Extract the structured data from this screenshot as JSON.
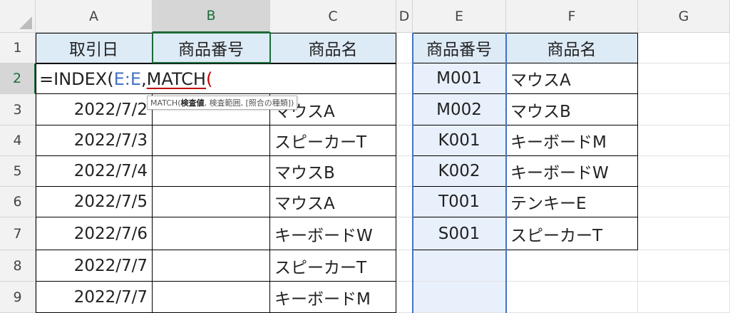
{
  "columns": [
    "A",
    "B",
    "C",
    "D",
    "E",
    "F",
    "G"
  ],
  "rows": [
    "1",
    "2",
    "3",
    "4",
    "5",
    "6",
    "7",
    "8",
    "9"
  ],
  "selected_column": "B",
  "selected_row": "2",
  "left_table": {
    "headers": [
      "取引日",
      "商品番号",
      "商品名"
    ],
    "rows": [
      [
        "",
        "",
        ""
      ],
      [
        "2022/7/2",
        "",
        "マウスA"
      ],
      [
        "2022/7/3",
        "",
        "スピーカーT"
      ],
      [
        "2022/7/4",
        "",
        "マウスB"
      ],
      [
        "2022/7/5",
        "",
        "マウスA"
      ],
      [
        "2022/7/6",
        "",
        "キーボードW"
      ],
      [
        "2022/7/7",
        "",
        "スピーカーT"
      ],
      [
        "2022/7/7",
        "",
        "キーボードM"
      ]
    ]
  },
  "right_table": {
    "headers": [
      "商品番号",
      "商品名"
    ],
    "rows": [
      [
        "M001",
        "マウスA"
      ],
      [
        "M002",
        "マウスB"
      ],
      [
        "K001",
        "キーボードM"
      ],
      [
        "K002",
        "キーボードW"
      ],
      [
        "T001",
        "テンキーE"
      ],
      [
        "S001",
        "スピーカーT"
      ],
      [
        "",
        ""
      ],
      [
        "",
        ""
      ]
    ]
  },
  "formula": {
    "prefix": "=INDEX(",
    "ref": "E:E",
    "comma": ",",
    "function": "MATCH",
    "paren": "("
  },
  "tooltip": {
    "fn": "MATCH(",
    "arg_bold": "検査値",
    "rest": ", 検査範囲, [照合の種類])"
  },
  "colors": {
    "header_fill": "#ddebf7",
    "range_highlight": "#4472c4",
    "active_border": "#1e6b3a",
    "error_underline": "#c00000"
  }
}
